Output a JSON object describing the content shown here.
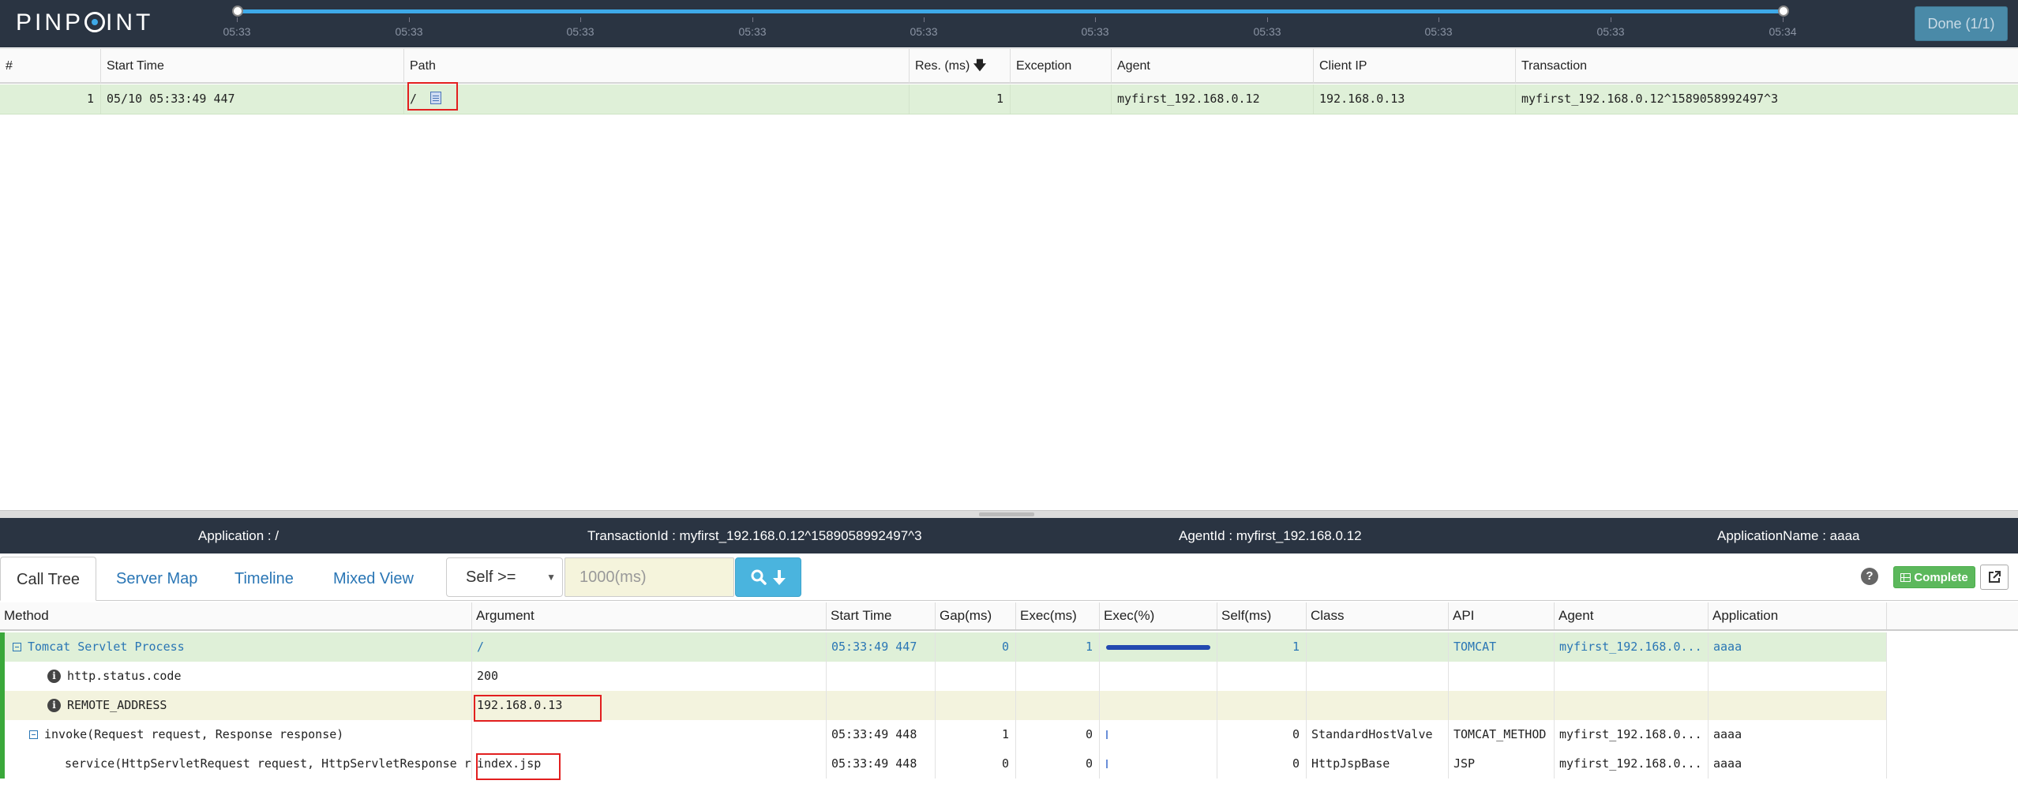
{
  "header": {
    "logo": "PINPOINT",
    "timeline_ticks": [
      "05:33",
      "05:33",
      "05:33",
      "05:33",
      "05:33",
      "05:33",
      "05:33",
      "05:33",
      "05:33",
      "05:34"
    ],
    "done_label": "Done (1/1)"
  },
  "tx_list": {
    "columns": [
      "#",
      "Start Time",
      "Path",
      "Res. (ms)",
      "Exception",
      "Agent",
      "Client IP",
      "Transaction"
    ],
    "sort_icon": "arrow-down-icon",
    "rows": [
      {
        "index": "1",
        "start_time": "05/10 05:33:49 447",
        "path": "/",
        "res_ms": "1",
        "exception": "",
        "agent": "myfirst_192.168.0.12",
        "client_ip": "192.168.0.13",
        "transaction": "myfirst_192.168.0.12^1589058992497^3"
      }
    ]
  },
  "info": {
    "application": "Application : /",
    "transaction_id": "TransactionId : myfirst_192.168.0.12^1589058992497^3",
    "agent_id": "AgentId : myfirst_192.168.0.12",
    "application_name": "ApplicationName : aaaa"
  },
  "toolbar": {
    "tabs": [
      "Call Tree",
      "Server Map",
      "Timeline",
      "Mixed View"
    ],
    "active_tab": "Call Tree",
    "filter_select": "Self >=",
    "filter_placeholder": "1000(ms)",
    "complete_label": "Complete",
    "help_label": "?"
  },
  "call_tree": {
    "columns": [
      "Method",
      "Argument",
      "Start Time",
      "Gap(ms)",
      "Exec(ms)",
      "Exec(%)",
      "Self(ms)",
      "Class",
      "API",
      "Agent",
      "Application"
    ],
    "rows": [
      {
        "method": "Tomcat Servlet Process",
        "argument": "/",
        "start_time": "05:33:49 447",
        "gap": "0",
        "exec": "1",
        "exec_pct": 100,
        "self": "1",
        "class": "",
        "api": "TOMCAT",
        "agent": "myfirst_192.168.0...",
        "application": "aaaa"
      },
      {
        "method": "http.status.code",
        "argument": "200"
      },
      {
        "method": "REMOTE_ADDRESS",
        "argument": "192.168.0.13"
      },
      {
        "method": "invoke(Request request, Response response)",
        "argument": "",
        "start_time": "05:33:49 448",
        "gap": "1",
        "exec": "0",
        "exec_pct": 0,
        "self": "0",
        "class": "StandardHostValve",
        "api": "TOMCAT_METHOD",
        "agent": "myfirst_192.168.0...",
        "application": "aaaa"
      },
      {
        "method": "service(HttpServletRequest request, HttpServletResponse r",
        "argument": "index.jsp",
        "start_time": "05:33:49 448",
        "gap": "0",
        "exec": "0",
        "exec_pct": 0,
        "self": "0",
        "class": "HttpJspBase",
        "api": "JSP",
        "agent": "myfirst_192.168.0...",
        "application": "aaaa"
      }
    ]
  },
  "colors": {
    "header_bg": "#2a3442",
    "accent": "#3ea9e8",
    "selected_row": "#dff0d8",
    "highlight_row": "#f3f3de",
    "exec_bar": "#2249b0",
    "annotation_red": "#e21f1f",
    "complete_green": "#5cb85c"
  }
}
